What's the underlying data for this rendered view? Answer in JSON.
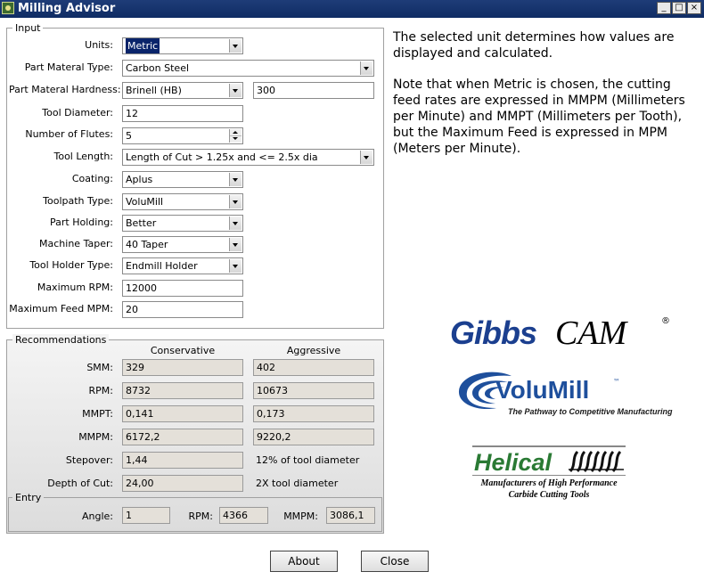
{
  "window": {
    "title": "Milling Advisor",
    "controls": {
      "minimize": "_",
      "maximize": "□",
      "close": "×"
    }
  },
  "input": {
    "legend": "Input",
    "units": {
      "label": "Units:",
      "value": "Metric"
    },
    "material_type": {
      "label": "Part Materal Type:",
      "value": "Carbon Steel"
    },
    "hardness": {
      "label": "Part Materal Hardness:",
      "scale": "Brinell (HB)",
      "value": "300"
    },
    "tool_diameter": {
      "label": "Tool Diameter:",
      "value": "12"
    },
    "flutes": {
      "label": "Number of Flutes:",
      "value": "5"
    },
    "tool_length": {
      "label": "Tool Length:",
      "value": "Length of Cut > 1.25x and <= 2.5x dia"
    },
    "coating": {
      "label": "Coating:",
      "value": "Aplus"
    },
    "toolpath_type": {
      "label": "Toolpath Type:",
      "value": "VoluMill"
    },
    "part_holding": {
      "label": "Part Holding:",
      "value": "Better"
    },
    "machine_taper": {
      "label": "Machine Taper:",
      "value": "40 Taper"
    },
    "tool_holder": {
      "label": "Tool Holder Type:",
      "value": "Endmill Holder"
    },
    "max_rpm": {
      "label": "Maximum RPM:",
      "value": "12000"
    },
    "max_feed": {
      "label": "Maximum Feed MPM:",
      "value": "20"
    }
  },
  "info": {
    "paragraph1": "The selected unit determines how values are displayed and calculated.",
    "paragraph2": "Note that when Metric is chosen, the cutting feed rates are expressed in MMPM (Millimeters per Minute) and MMPT (Millimeters per Tooth), but the Maximum Feed is expressed in MPM (Meters per Minute)."
  },
  "recommendations": {
    "legend": "Recommendations",
    "col_conservative": "Conservative",
    "col_aggressive": "Aggressive",
    "smm": {
      "label": "SMM:",
      "conservative": "329",
      "aggressive": "402"
    },
    "rpm": {
      "label": "RPM:",
      "conservative": "8732",
      "aggressive": "10673"
    },
    "mmpt": {
      "label": "MMPT:",
      "conservative": "0,141",
      "aggressive": "0,173"
    },
    "mmpm": {
      "label": "MMPM:",
      "conservative": "6172,2",
      "aggressive": "9220,2"
    },
    "stepover": {
      "label": "Stepover:",
      "value": "1,44",
      "note": "12% of tool diameter"
    },
    "depth_of_cut": {
      "label": "Depth of Cut:",
      "value": "24,00",
      "note": "2X tool diameter"
    }
  },
  "entry": {
    "legend": "Entry",
    "angle": {
      "label": "Angle:",
      "value": "1"
    },
    "rpm": {
      "label": "RPM:",
      "value": "4366"
    },
    "mmpm": {
      "label": "MMPM:",
      "value": "3086,1"
    }
  },
  "logos": {
    "gibbscam": {
      "text_gibbs": "Gibbs",
      "text_cam": "CAM",
      "mark": "®"
    },
    "volumill": {
      "name": "VoluMill",
      "tm": "™",
      "tagline": "The Pathway to Competitive Manufacturing"
    },
    "helical": {
      "name": "Helical",
      "line1": "Manufacturers of High Performance",
      "line2": "Carbide Cutting Tools"
    }
  },
  "buttons": {
    "about": "About",
    "close": "Close"
  },
  "colors": {
    "titlebar": "#0f2c64",
    "gibbs_blue": "#1b3f8f",
    "volumill_blue": "#1e4f9c",
    "helical_green": "#2a7a34",
    "selection": "#0a246a"
  }
}
